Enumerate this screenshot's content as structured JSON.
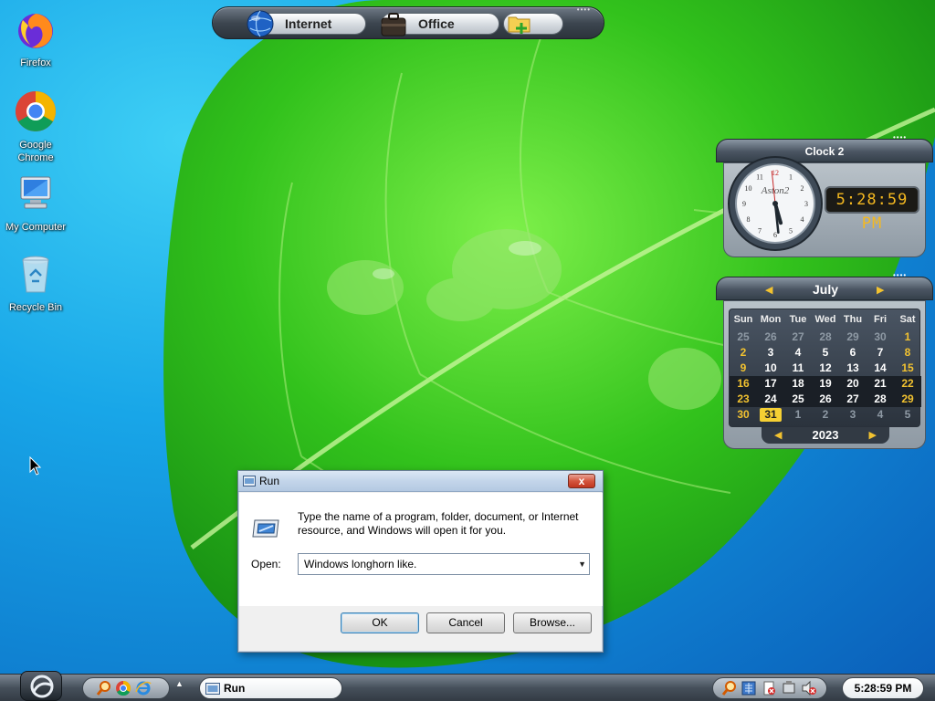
{
  "desktop": {
    "icons": [
      {
        "label": "Firefox"
      },
      {
        "label": "Google Chrome"
      },
      {
        "label": "My Computer"
      },
      {
        "label": "Recycle Bin"
      }
    ]
  },
  "topbar": {
    "items": [
      {
        "label": "Internet",
        "icon": "globe-icon"
      },
      {
        "label": "Office",
        "icon": "briefcase-icon"
      },
      {
        "label": "",
        "icon": "add-folder-icon"
      }
    ]
  },
  "clock_widget": {
    "title": "Clock 2",
    "brand": "Aston2",
    "digital_time": "5:28:59 PM",
    "hours": 5,
    "minutes": 28,
    "seconds": 59
  },
  "calendar_widget": {
    "month": "July",
    "year": "2023",
    "weekdays": [
      "Sun",
      "Mon",
      "Tue",
      "Wed",
      "Thu",
      "Fri",
      "Sat"
    ],
    "weeks": [
      [
        "25",
        "26",
        "27",
        "28",
        "29",
        "30",
        "1"
      ],
      [
        "2",
        "3",
        "4",
        "5",
        "6",
        "7",
        "8"
      ],
      [
        "9",
        "10",
        "11",
        "12",
        "13",
        "14",
        "15"
      ],
      [
        "16",
        "17",
        "18",
        "19",
        "20",
        "21",
        "22"
      ],
      [
        "23",
        "24",
        "25",
        "26",
        "27",
        "28",
        "29"
      ],
      [
        "30",
        "31",
        "1",
        "2",
        "3",
        "4",
        "5"
      ]
    ],
    "today": "31"
  },
  "run_dialog": {
    "title": "Run",
    "description": "Type the name of a program, folder, document, or Internet resource, and Windows will open it for you.",
    "open_label": "Open:",
    "open_value": "Windows longhorn like.",
    "ok_label": "OK",
    "cancel_label": "Cancel",
    "browse_label": "Browse...",
    "close_label": "x"
  },
  "taskbar": {
    "task_label": "Run",
    "clock": "5:28:59 PM"
  },
  "colors": {
    "accent": "#3c7fb1",
    "calendar_weekend": "#f2c230",
    "digital_clock": "#f4b820",
    "close_button": "#d4553e"
  }
}
